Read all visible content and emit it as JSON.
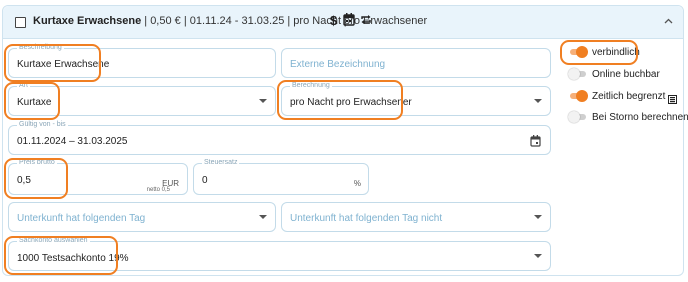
{
  "header": {
    "title_bold": "Kurtaxe Erwachsene",
    "title_rest": " | 0,50 € | 01.11.24 - 31.03.25 | pro Nacht pro Erwachsener"
  },
  "icons": [
    "dollar-icon",
    "calendar-icon",
    "repeat-icon",
    "chevron-up-icon",
    "calendar-icon",
    "list-icon"
  ],
  "fields": {
    "beschreibung": {
      "label": "Beschreibung",
      "value": "Kurtaxe Erwachsene"
    },
    "externe": {
      "placeholder": "Externe Bezeichnung"
    },
    "art": {
      "label": "Art",
      "value": "Kurtaxe"
    },
    "berechnung": {
      "label": "Berechnung",
      "value": "pro Nacht pro Erwachsener"
    },
    "gueltig": {
      "label": "Gültig von - bis",
      "value": "01.11.2024 – 31.03.2025"
    },
    "preis": {
      "label": "Preis brutto",
      "value": "0,5",
      "suffix": "EUR",
      "hint": "netto 0,5"
    },
    "steuersatz": {
      "label": "Steuersatz",
      "value": "0",
      "suffix": "%"
    },
    "tag": {
      "placeholder": "Unterkunft hat folgenden Tag"
    },
    "tag_nicht": {
      "placeholder": "Unterkunft hat folgenden Tag nicht"
    },
    "sachkonto": {
      "label": "Sachkonto auswählen",
      "value": "1000 Testsachkonto 19%"
    }
  },
  "toggles": [
    {
      "label": "verbindlich",
      "on": true
    },
    {
      "label": "Online buchbar",
      "on": false
    },
    {
      "label": "Zeitlich begrenzt",
      "on": true
    },
    {
      "label": "Bei Storno berechnen",
      "on": false
    }
  ],
  "colors": {
    "accent": "#f07f22",
    "header_bg": "#e9f4fb",
    "border": "#c3dbe9"
  }
}
